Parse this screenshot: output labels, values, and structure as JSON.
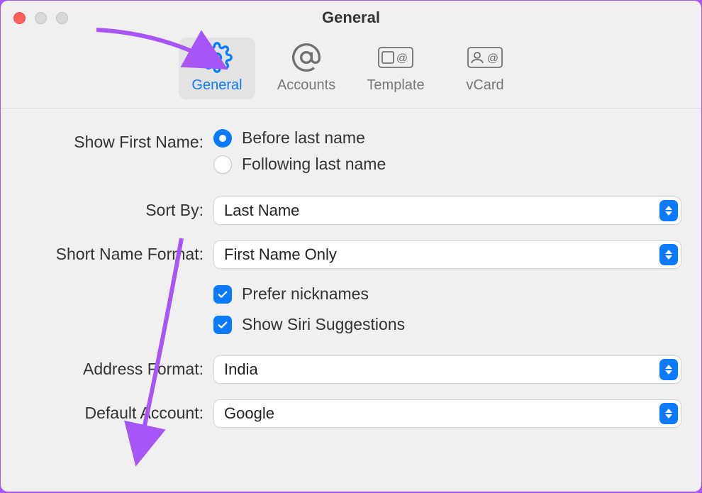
{
  "window": {
    "title": "General"
  },
  "tabs": {
    "general": {
      "label": "General"
    },
    "accounts": {
      "label": "Accounts"
    },
    "template": {
      "label": "Template"
    },
    "vcard": {
      "label": "vCard"
    }
  },
  "form": {
    "show_first_name": {
      "label": "Show First Name:",
      "options": {
        "before": "Before last name",
        "following": "Following last name"
      }
    },
    "sort_by": {
      "label": "Sort By:",
      "value": "Last Name"
    },
    "short_name_format": {
      "label": "Short Name Format:",
      "value": "First Name Only"
    },
    "prefer_nicknames": {
      "label": "Prefer nicknames"
    },
    "siri_suggestions": {
      "label": "Show Siri Suggestions"
    },
    "address_format": {
      "label": "Address Format:",
      "value": "India"
    },
    "default_account": {
      "label": "Default Account:",
      "value": "Google"
    }
  }
}
